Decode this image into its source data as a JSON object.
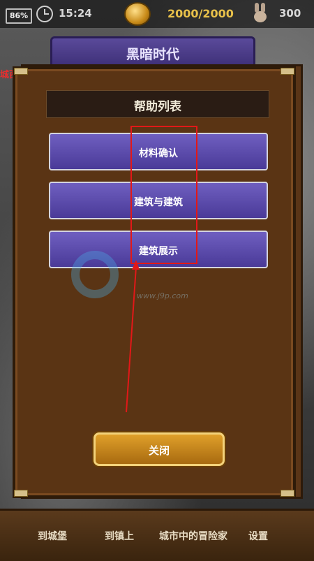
{
  "status_bar": {
    "battery": "86%",
    "time": "15:24",
    "gold": "2000/2000",
    "population": "300"
  },
  "header": {
    "title": "黑暗时代"
  },
  "side_tag": "城西",
  "help_panel": {
    "title": "帮助列表",
    "items": [
      {
        "label": "材料确认"
      },
      {
        "label": "建筑与建筑"
      },
      {
        "label": "建筑展示"
      }
    ],
    "close_label": "关闭"
  },
  "watermark": {
    "text": "www.j9p.com"
  },
  "bottom_nav": [
    {
      "label": "到城堡"
    },
    {
      "label": "到镇上"
    },
    {
      "label": "城市中的冒险家"
    },
    {
      "label": "设置"
    }
  ],
  "colors": {
    "help_button": "#5a4aa8",
    "close_button": "#c88a1c",
    "panel": "#5a3414",
    "highlight": "#e21818"
  }
}
